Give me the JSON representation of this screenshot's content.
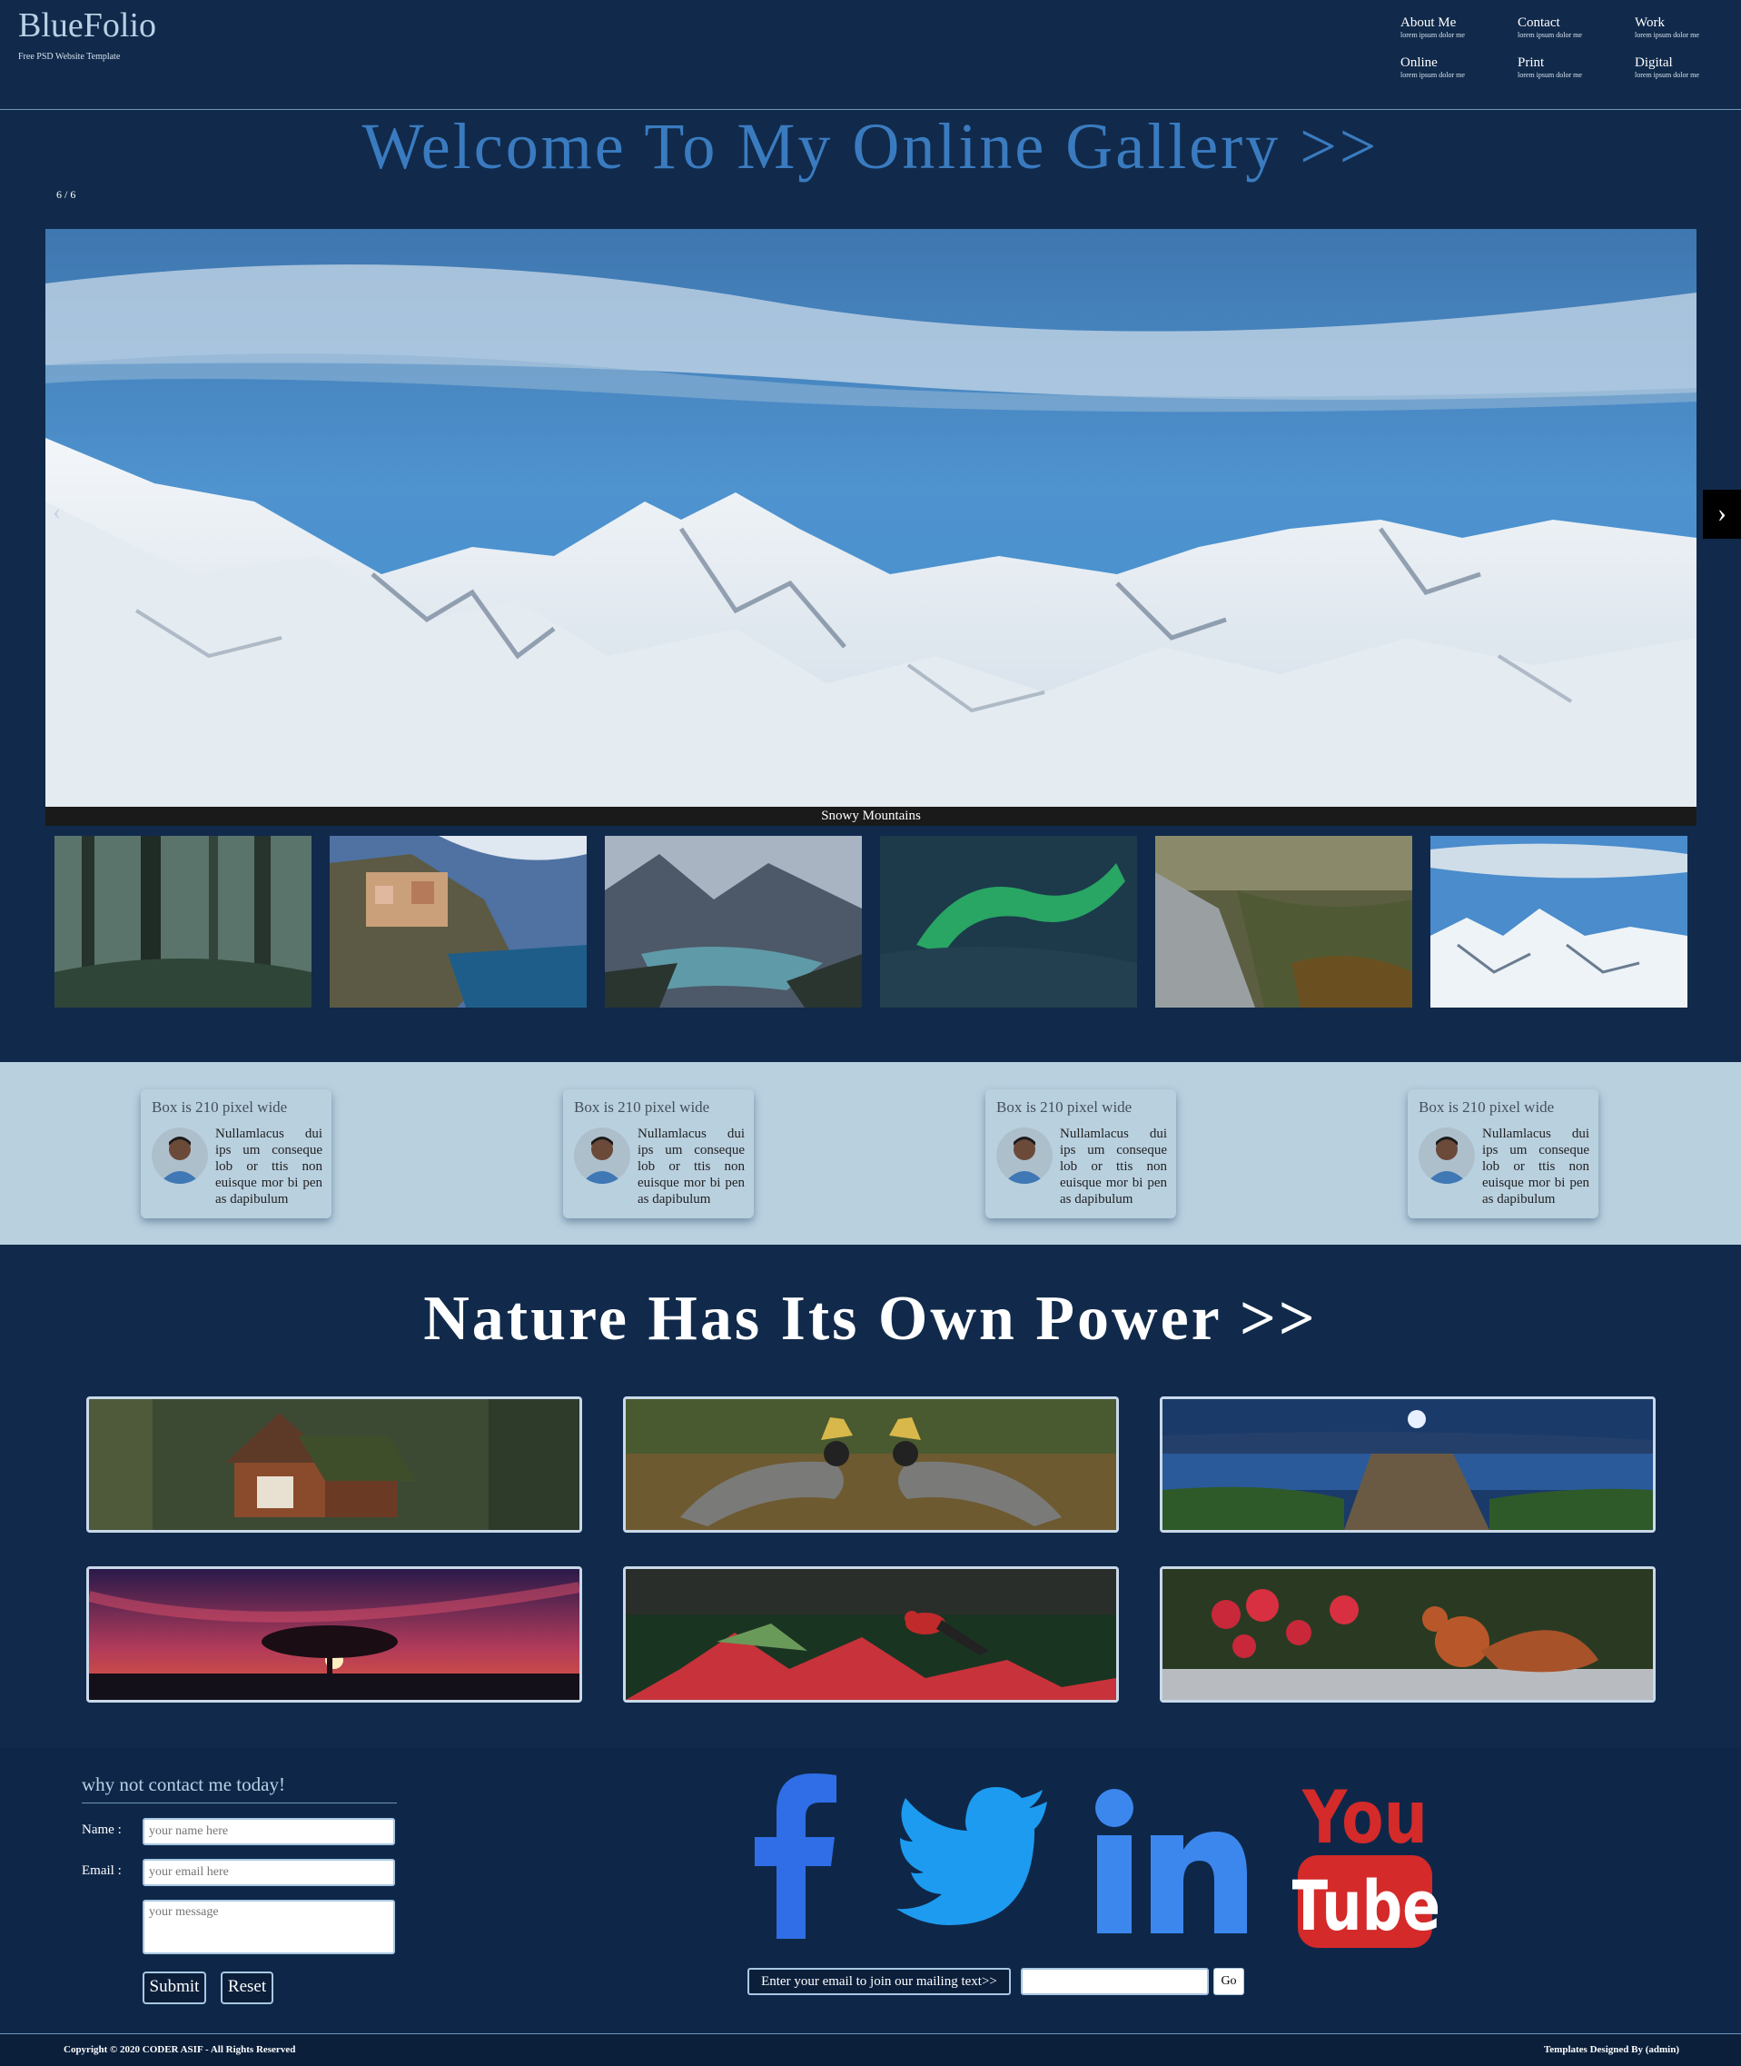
{
  "header": {
    "brand": "BlueFolio",
    "tagline": "Free PSD Website Template",
    "nav": [
      {
        "title": "About Me",
        "sub": "lorem ipsum dolor me"
      },
      {
        "title": "Contact",
        "sub": "lorem ipsum dolor me"
      },
      {
        "title": "Work",
        "sub": "lorem ipsum dolor me"
      },
      {
        "title": "Online",
        "sub": "lorem ipsum dolor me"
      },
      {
        "title": "Print",
        "sub": "lorem ipsum dolor me"
      },
      {
        "title": "Digital",
        "sub": "lorem ipsum dolor me"
      }
    ]
  },
  "gallery": {
    "title": "Welcome To My Online Gallery >>",
    "counter": "6 / 6",
    "caption": "Snowy Mountains",
    "prev": "‹",
    "next": "›",
    "thumbnails": [
      "forest",
      "coastal-village",
      "mountain-lake",
      "aurora",
      "valley",
      "snowy-mountains"
    ]
  },
  "boxes": [
    {
      "title": "Box is 210 pixel wide",
      "text": "Nullamlacus dui ips um conseque lob or ttis non euisque mor bi pen as dapibulum"
    },
    {
      "title": "Box is 210 pixel wide",
      "text": "Nullamlacus dui ips um conseque lob or ttis non euisque mor bi pen as dapibulum"
    },
    {
      "title": "Box is 210 pixel wide",
      "text": "Nullamlacus dui ips um conseque lob or ttis non euisque mor bi pen as dapibulum"
    },
    {
      "title": "Box is 210 pixel wide",
      "text": "Nullamlacus dui ips um conseque lob or ttis non euisque mor bi pen as dapibulum"
    }
  ],
  "nature": {
    "title": "Nature Has Its Own Power >>",
    "images": [
      "forest-cabin",
      "crowned-cranes",
      "lake-pier",
      "sunset-tree",
      "red-bird-flowers",
      "squirrel-flowers"
    ]
  },
  "contact": {
    "heading": "why not contact me today!",
    "name_label": "Name :",
    "name_placeholder": "your name here",
    "email_label": "Email :",
    "email_placeholder": "your email here",
    "message_placeholder": "your message",
    "submit": "Submit",
    "reset": "Reset"
  },
  "social": {
    "icons": [
      "facebook-icon",
      "twitter-icon",
      "linkedin-icon",
      "youtube-icon"
    ],
    "youtube_top": "You",
    "youtube_bottom": "Tube"
  },
  "mailing": {
    "label": "Enter your email to join our mailing text>>",
    "go": "Go"
  },
  "footer": {
    "copyright": "Copyright © 2020 CODER ASIF - All Rights Reserved",
    "designed": "Templates Designed By (admin)"
  },
  "colors": {
    "page_bg": "#112a4b",
    "title_blue": "#3a7bc0",
    "box_band": "#b9d0df",
    "facebook": "#2f6ee6",
    "twitter": "#1d9bf0",
    "linkedin": "#3b87ee",
    "youtube": "#d42a2a"
  }
}
